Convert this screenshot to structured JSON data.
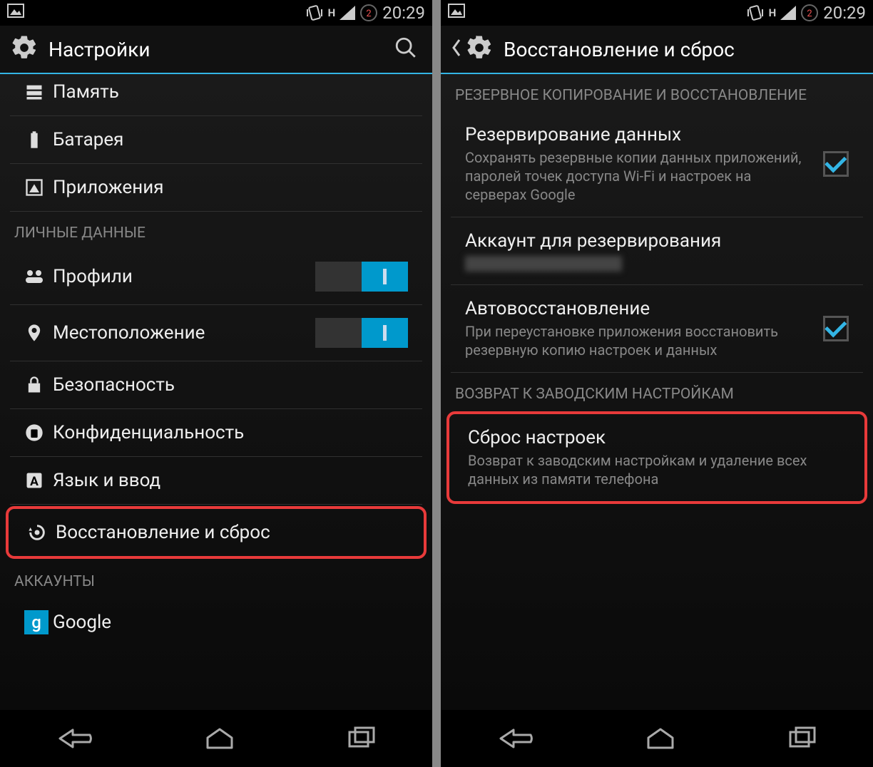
{
  "status": {
    "time": "20:29",
    "net_label": "H"
  },
  "left": {
    "title": "Настройки",
    "items": {
      "memory": "Память",
      "battery": "Батарея",
      "apps": "Приложения"
    },
    "section_personal": "ЛИЧНЫЕ ДАННЫЕ",
    "personal": {
      "profiles": "Профили",
      "location": "Местоположение",
      "security": "Безопасность",
      "privacy": "Конфиденциальность",
      "language": "Язык и ввод",
      "backup_reset": "Восстановление и сброс"
    },
    "section_accounts": "АККАУНТЫ",
    "accounts": {
      "google": "Google"
    }
  },
  "right": {
    "title": "Восстановление и сброс",
    "section_backup": "РЕЗЕРВНОЕ КОПИРОВАНИЕ И ВОССТАНОВЛЕНИЕ",
    "backup_data": {
      "title": "Резервирование данных",
      "sub": "Сохранять резервные копии данных приложений, паролей точек доступа Wi-Fi и настроек на серверах Google"
    },
    "backup_account": {
      "title": "Аккаунт для резервирования"
    },
    "auto_restore": {
      "title": "Автовосстановление",
      "sub": "При переустановке приложения восстановить резервную копию настроек и данных"
    },
    "section_factory": "ВОЗВРАТ К ЗАВОДСКИМ НАСТРОЙКАМ",
    "factory_reset": {
      "title": "Сброс настроек",
      "sub": "Возврат к заводским настройкам и удаление всех данных из памяти телефона"
    }
  }
}
